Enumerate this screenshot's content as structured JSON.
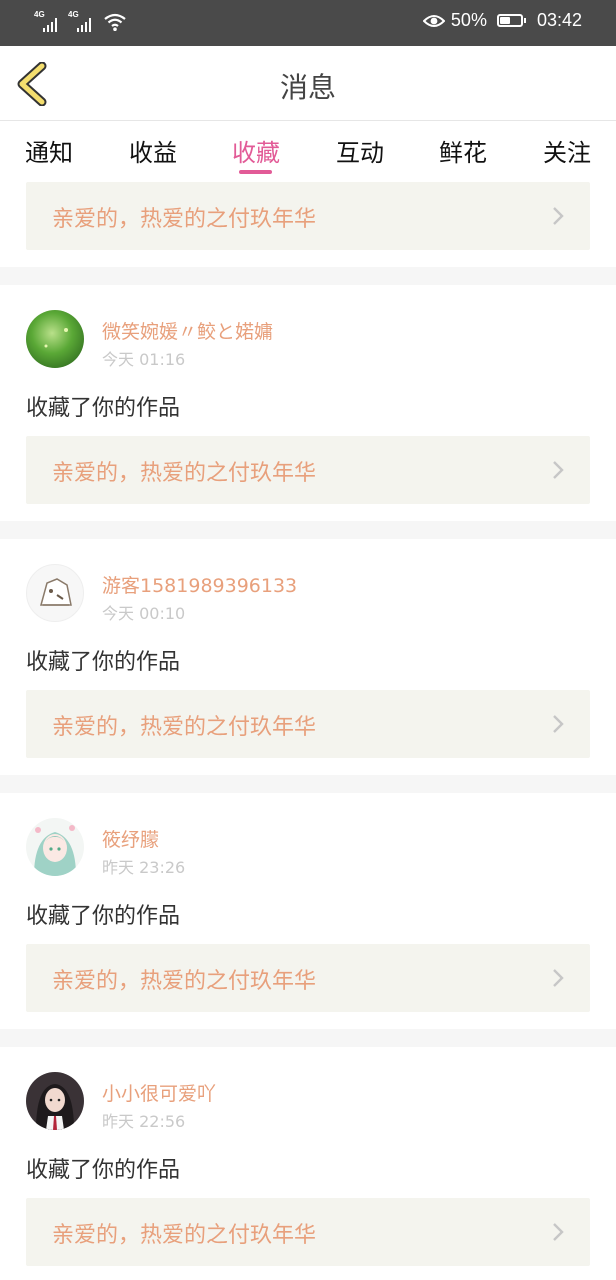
{
  "status_bar": {
    "network_1": "4G",
    "network_2": "4G",
    "battery_percent": "50%",
    "battery_level": 0.5,
    "time": "03:42"
  },
  "header": {
    "title": "消息",
    "back_icon": "chevron-left-icon"
  },
  "tabs": [
    {
      "label": "通知",
      "active": false
    },
    {
      "label": "收益",
      "active": false
    },
    {
      "label": "收藏",
      "active": true
    },
    {
      "label": "互动",
      "active": false
    },
    {
      "label": "鲜花",
      "active": false
    },
    {
      "label": "关注",
      "active": false
    }
  ],
  "colors": {
    "accent": "#e25b97",
    "username": "#e8a07c",
    "card_bg": "#f4f4ee"
  },
  "top_card": {
    "title": "亲爱的，热爱的之付玖年华"
  },
  "messages": [
    {
      "user": "微笑婉媛〃鲛と婼嫞",
      "time": "今天 01:16",
      "action": "收藏了你的作品",
      "work": "亲爱的，热爱的之付玖年华"
    },
    {
      "user": "游客1581989396133",
      "time": "今天 00:10",
      "action": "收藏了你的作品",
      "work": "亲爱的，热爱的之付玖年华"
    },
    {
      "user": "筱纾朦",
      "time": "昨天 23:26",
      "action": "收藏了你的作品",
      "work": "亲爱的，热爱的之付玖年华"
    },
    {
      "user": "小小很可爱吖",
      "time": "昨天 22:56",
      "action": "收藏了你的作品",
      "work": "亲爱的，热爱的之付玖年华"
    }
  ]
}
